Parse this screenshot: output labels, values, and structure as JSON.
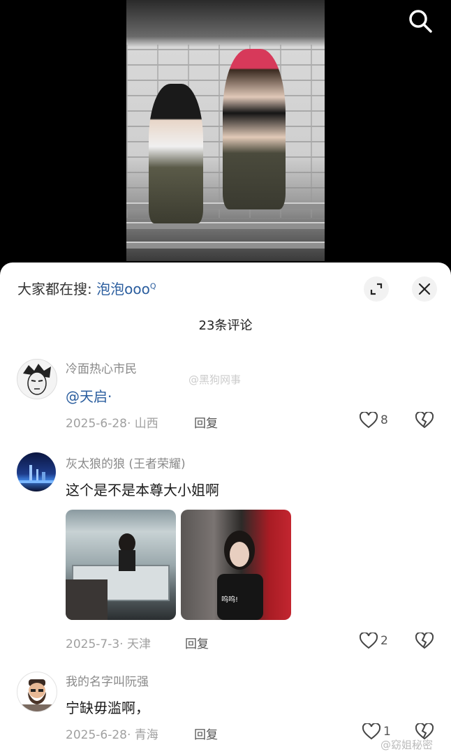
{
  "sheet": {
    "hot_search_prefix": "大家都在搜:",
    "hot_search_keyword": "泡泡ooo",
    "comment_count_label": "23条评论"
  },
  "comments": [
    {
      "user": "冷面热心市民",
      "mention": "@天启·",
      "text": "",
      "date_location": "2025-6-28· 山西",
      "reply_label": "回复",
      "likes": "8",
      "avatar_icon": "manga-portrait-icon"
    },
    {
      "user": "灰太狼的狼 (王者荣耀)",
      "text": "这个是不是本尊大小姐啊",
      "date_location": "2025-7-3· 天津",
      "reply_label": "回复",
      "likes": "2",
      "avatar_icon": "night-city-icon",
      "images": [
        {
          "caption": "",
          "icon": "photo-shop-counter"
        },
        {
          "caption": "呜呜!",
          "icon": "photo-girl-crying"
        }
      ]
    },
    {
      "user": "我的名字叫阮强",
      "text": "宁缺毋滥啊，",
      "date_location": "2025-6-28· 青海",
      "reply_label": "回复",
      "likes": "1",
      "avatar_icon": "bearded-man-icon"
    }
  ],
  "watermarks": {
    "mid": "@黑狗网事",
    "bottom": "@窈姐秘密"
  },
  "colors": {
    "link": "#2a5d9e",
    "meta": "#a0a0a0"
  }
}
